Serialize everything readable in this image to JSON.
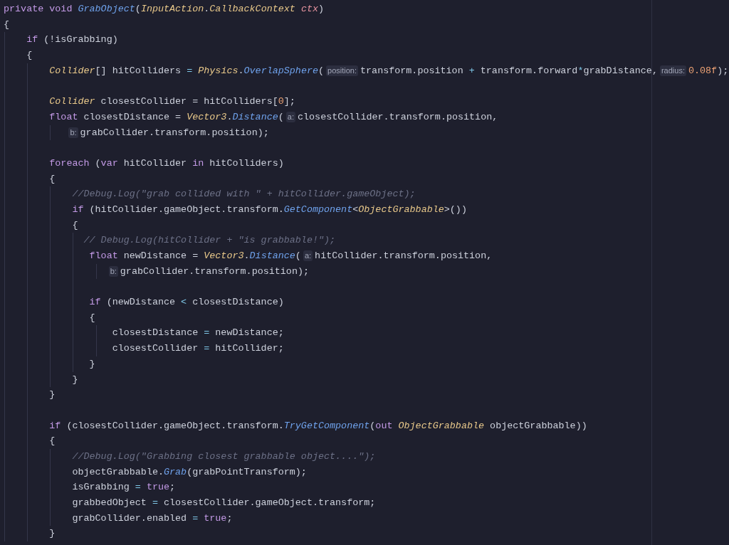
{
  "editor": {
    "lines": [
      {
        "kind": "code",
        "segments": [
          {
            "kind": "code",
            "tokens": [
              {
                "text": "private void ",
                "kind": "keyword"
              },
              {
                "text": "GrabObject",
                "kind": "method"
              },
              {
                "text": "(",
                "kind": "plain"
              },
              {
                "text": "InputAction",
                "kind": "type"
              },
              {
                "text": ".",
                "kind": "plain"
              },
              {
                "text": "CallbackContext ",
                "kind": "type"
              },
              {
                "text": "ctx",
                "kind": "param"
              },
              {
                "text": ")",
                "kind": "plain"
              }
            ]
          }
        ]
      },
      {
        "kind": "code",
        "segments": [
          {
            "kind": "code",
            "tokens": [
              {
                "text": "{",
                "kind": "plain"
              }
            ]
          }
        ]
      },
      {
        "kind": "code",
        "segments": [
          {
            "kind": "code",
            "tokens": [
              {
                "text": "    if",
                "kind": "keyword"
              },
              {
                "text": " (!isGrabbing)",
                "kind": "plain"
              }
            ]
          }
        ]
      },
      {
        "kind": "code",
        "segments": [
          {
            "kind": "code",
            "tokens": [
              {
                "text": "    {",
                "kind": "plain"
              }
            ]
          }
        ]
      },
      {
        "kind": "code",
        "segments": [
          {
            "kind": "code",
            "tokens": [
              {
                "text": "        Collider",
                "kind": "type"
              },
              {
                "text": "[] hitColliders ",
                "kind": "plain"
              },
              {
                "text": "= ",
                "kind": "operator"
              },
              {
                "text": "Physics",
                "kind": "type"
              },
              {
                "text": ".",
                "kind": "plain"
              },
              {
                "text": "OverlapSphere",
                "kind": "method"
              },
              {
                "text": "(",
                "kind": "plain"
              }
            ]
          },
          {
            "kind": "hint",
            "text": "position:"
          },
          {
            "kind": "code",
            "tokens": [
              {
                "text": "transform.position ",
                "kind": "plain"
              },
              {
                "text": "+",
                "kind": "operator"
              },
              {
                "text": " transform.forward",
                "kind": "plain"
              },
              {
                "text": "*",
                "kind": "operator"
              },
              {
                "text": "grabDistance,",
                "kind": "plain"
              }
            ]
          },
          {
            "kind": "hint",
            "text": "radius:"
          },
          {
            "kind": "code",
            "tokens": [
              {
                "text": "0.08f",
                "kind": "number"
              },
              {
                "text": ");",
                "kind": "plain"
              }
            ]
          }
        ]
      },
      {
        "kind": "blank"
      },
      {
        "kind": "code",
        "segments": [
          {
            "kind": "code",
            "tokens": [
              {
                "text": "        Collider",
                "kind": "type"
              },
              {
                "text": " closestCollider = hitColliders[",
                "kind": "plain"
              },
              {
                "text": "0",
                "kind": "number"
              },
              {
                "text": "];",
                "kind": "plain"
              }
            ]
          }
        ]
      },
      {
        "kind": "code",
        "segments": [
          {
            "kind": "code",
            "tokens": [
              {
                "text": "        float",
                "kind": "keyword"
              },
              {
                "text": " closestDistance = ",
                "kind": "plain"
              },
              {
                "text": "Vector3",
                "kind": "type"
              },
              {
                "text": ".",
                "kind": "plain"
              },
              {
                "text": "Distance",
                "kind": "method"
              },
              {
                "text": "(",
                "kind": "plain"
              }
            ]
          },
          {
            "kind": "hint",
            "text": "a:"
          },
          {
            "kind": "code",
            "tokens": [
              {
                "text": "closestCollider.transform.position,",
                "kind": "plain"
              }
            ]
          }
        ]
      },
      {
        "kind": "code",
        "segments": [
          {
            "kind": "hint",
            "text": "b:"
          },
          {
            "kind": "code",
            "tokens": [
              {
                "text": "grabCollider.transform.position);",
                "kind": "plain"
              }
            ]
          }
        ]
      },
      {
        "kind": "blank"
      },
      {
        "kind": "code",
        "segments": [
          {
            "kind": "code",
            "tokens": [
              {
                "text": "        foreach",
                "kind": "keyword"
              },
              {
                "text": " (",
                "kind": "plain"
              },
              {
                "text": "var",
                "kind": "keyword"
              },
              {
                "text": " hitCollider ",
                "kind": "plain"
              },
              {
                "text": "in",
                "kind": "keyword"
              },
              {
                "text": " hitColliders)",
                "kind": "plain"
              }
            ]
          }
        ]
      },
      {
        "kind": "code",
        "segments": [
          {
            "kind": "code",
            "tokens": [
              {
                "text": "        {",
                "kind": "plain"
              }
            ]
          }
        ]
      },
      {
        "kind": "code",
        "segments": [
          {
            "kind": "code",
            "tokens": [
              {
                "text": "            //Debug.Log(\"grab collided with \" + hitCollider.gameObject);",
                "kind": "comment"
              }
            ]
          }
        ]
      },
      {
        "kind": "code",
        "segments": [
          {
            "kind": "code",
            "tokens": [
              {
                "text": "            if",
                "kind": "keyword"
              },
              {
                "text": " (hitCollider.gameObject.transform.",
                "kind": "plain"
              },
              {
                "text": "GetComponent",
                "kind": "method"
              },
              {
                "text": "<",
                "kind": "plain"
              },
              {
                "text": "ObjectGrabbable",
                "kind": "type"
              },
              {
                "text": ">())",
                "kind": "plain"
              }
            ]
          }
        ]
      },
      {
        "kind": "code",
        "segments": [
          {
            "kind": "code",
            "tokens": [
              {
                "text": "            {",
                "kind": "plain"
              }
            ]
          }
        ]
      },
      {
        "kind": "code",
        "segments": [
          {
            "kind": "code",
            "tokens": [
              {
                "text": "              // Debug.Log(hitCollider + \"is grabbable!\");",
                "kind": "comment"
              }
            ]
          }
        ]
      },
      {
        "kind": "code",
        "segments": [
          {
            "kind": "code",
            "tokens": [
              {
                "text": "               float",
                "kind": "keyword"
              },
              {
                "text": " newDistance = ",
                "kind": "plain"
              },
              {
                "text": "Vector3",
                "kind": "type"
              },
              {
                "text": ".",
                "kind": "plain"
              },
              {
                "text": "Distance",
                "kind": "method"
              },
              {
                "text": "(",
                "kind": "plain"
              }
            ]
          },
          {
            "kind": "hint",
            "text": "a:"
          },
          {
            "kind": "code",
            "tokens": [
              {
                "text": "hitCollider.transform.position,",
                "kind": "plain"
              }
            ]
          }
        ]
      },
      {
        "kind": "code",
        "segments": [
          {
            "kind": "hint",
            "text": "b:"
          },
          {
            "kind": "code",
            "tokens": [
              {
                "text": "grabCollider.transform.position);",
                "kind": "plain"
              }
            ]
          }
        ]
      },
      {
        "kind": "blank"
      },
      {
        "kind": "code",
        "segments": [
          {
            "kind": "code",
            "tokens": [
              {
                "text": "               if",
                "kind": "keyword"
              },
              {
                "text": " (newDistance ",
                "kind": "plain"
              },
              {
                "text": "<",
                "kind": "operator"
              },
              {
                "text": " closestDistance)",
                "kind": "plain"
              }
            ]
          }
        ]
      },
      {
        "kind": "code",
        "segments": [
          {
            "kind": "code",
            "tokens": [
              {
                "text": "               {",
                "kind": "plain"
              }
            ]
          }
        ]
      },
      {
        "kind": "code",
        "segments": [
          {
            "kind": "code",
            "tokens": [
              {
                "text": "                   closestDistance ",
                "kind": "plain"
              },
              {
                "text": "=",
                "kind": "operator"
              },
              {
                "text": " newDistance;",
                "kind": "plain"
              }
            ]
          }
        ]
      },
      {
        "kind": "code",
        "segments": [
          {
            "kind": "code",
            "tokens": [
              {
                "text": "                   closestCollider ",
                "kind": "plain"
              },
              {
                "text": "=",
                "kind": "operator"
              },
              {
                "text": " hitCollider;",
                "kind": "plain"
              }
            ]
          }
        ]
      },
      {
        "kind": "code",
        "segments": [
          {
            "kind": "code",
            "tokens": [
              {
                "text": "               }",
                "kind": "plain"
              }
            ]
          }
        ]
      },
      {
        "kind": "code",
        "segments": [
          {
            "kind": "code",
            "tokens": [
              {
                "text": "            }",
                "kind": "plain"
              }
            ]
          }
        ]
      },
      {
        "kind": "code",
        "segments": [
          {
            "kind": "code",
            "tokens": [
              {
                "text": "        }",
                "kind": "plain"
              }
            ]
          }
        ]
      },
      {
        "kind": "blank"
      },
      {
        "kind": "code",
        "segments": [
          {
            "kind": "code",
            "tokens": [
              {
                "text": "        if",
                "kind": "keyword"
              },
              {
                "text": " (closestCollider.gameObject.transform.",
                "kind": "plain"
              },
              {
                "text": "TryGetComponent",
                "kind": "method"
              },
              {
                "text": "(",
                "kind": "plain"
              },
              {
                "text": "out ",
                "kind": "keyword"
              },
              {
                "text": "ObjectGrabbable",
                "kind": "type"
              },
              {
                "text": " objectGrabbable))",
                "kind": "plain"
              }
            ]
          }
        ]
      },
      {
        "kind": "code",
        "segments": [
          {
            "kind": "code",
            "tokens": [
              {
                "text": "        {",
                "kind": "plain"
              }
            ]
          }
        ]
      },
      {
        "kind": "code",
        "segments": [
          {
            "kind": "code",
            "tokens": [
              {
                "text": "            //Debug.Log(\"Grabbing closest grabbable object....\");",
                "kind": "comment"
              }
            ]
          }
        ]
      },
      {
        "kind": "code",
        "segments": [
          {
            "kind": "code",
            "tokens": [
              {
                "text": "            objectGrabbable.",
                "kind": "plain"
              },
              {
                "text": "Grab",
                "kind": "method"
              },
              {
                "text": "(grabPointTransform);",
                "kind": "plain"
              }
            ]
          }
        ]
      },
      {
        "kind": "code",
        "segments": [
          {
            "kind": "code",
            "tokens": [
              {
                "text": "            isGrabbing ",
                "kind": "plain"
              },
              {
                "text": "= ",
                "kind": "operator"
              },
              {
                "text": "true",
                "kind": "keyword"
              },
              {
                "text": ";",
                "kind": "plain"
              }
            ]
          }
        ]
      },
      {
        "kind": "code",
        "segments": [
          {
            "kind": "code",
            "tokens": [
              {
                "text": "            grabbedObject ",
                "kind": "plain"
              },
              {
                "text": "=",
                "kind": "operator"
              },
              {
                "text": " closestCollider.gameObject.transform;",
                "kind": "plain"
              }
            ]
          }
        ]
      },
      {
        "kind": "code",
        "segments": [
          {
            "kind": "code",
            "tokens": [
              {
                "text": "            grabCollider.enabled ",
                "kind": "plain"
              },
              {
                "text": "= ",
                "kind": "operator"
              },
              {
                "text": "true",
                "kind": "keyword"
              },
              {
                "text": ";",
                "kind": "plain"
              }
            ]
          }
        ]
      },
      {
        "kind": "code",
        "segments": [
          {
            "kind": "code",
            "tokens": [
              {
                "text": "        }",
                "kind": "plain"
              }
            ]
          }
        ]
      }
    ]
  }
}
